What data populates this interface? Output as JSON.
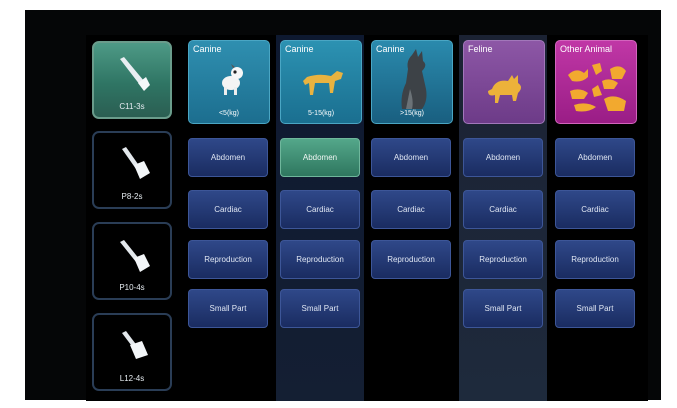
{
  "probes": [
    {
      "name": "C11-3s",
      "selected": true
    },
    {
      "name": "P8-2s",
      "selected": false
    },
    {
      "name": "P10-4s",
      "selected": false
    },
    {
      "name": "L12-4s",
      "selected": false
    }
  ],
  "species": [
    {
      "title": "Canine",
      "sub": "<5(kg)"
    },
    {
      "title": "Canine",
      "sub": "5-15(kg)"
    },
    {
      "title": "Canine",
      "sub": ">15(kg)"
    },
    {
      "title": "Feline",
      "sub": ""
    },
    {
      "title": "Other Animal",
      "sub": ""
    }
  ],
  "exams": {
    "col0": [
      "Abdomen",
      "Cardiac",
      "Reproduction",
      "Small Part"
    ],
    "col1": [
      "Abdomen",
      "Cardiac",
      "Reproduction",
      "Small Part"
    ],
    "col2": [
      "Abdomen",
      "Cardiac",
      "Reproduction"
    ],
    "col3": [
      "Abdomen",
      "Cardiac",
      "Reproduction",
      "Small Part"
    ],
    "col4": [
      "Abdomen",
      "Cardiac",
      "Reproduction",
      "Small Part"
    ]
  },
  "selected_exam": {
    "column": 1,
    "label": "Abdomen"
  },
  "colors": {
    "selected": "#3f8f77",
    "button": "#26397a",
    "feline": "#7e4b98",
    "other": "#b02a98",
    "canine": "#2580a5"
  }
}
